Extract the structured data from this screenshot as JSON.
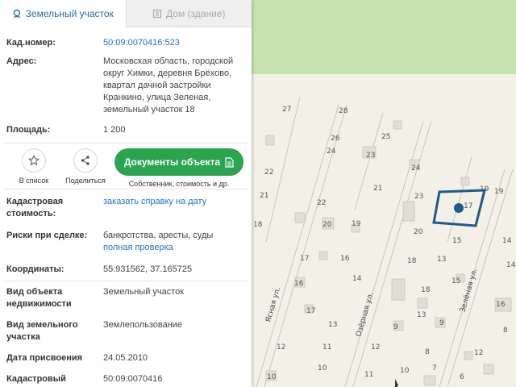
{
  "tabs": {
    "land": "Земельный участок",
    "building": "Дом (здание)"
  },
  "fields": {
    "cadastral_number": {
      "label": "Кад.номер:",
      "value": "50:09:0070416:523"
    },
    "address": {
      "label": "Адрес:",
      "lines": [
        "Московская область, городской",
        "округ Химки, деревня Брёхово,",
        "квартал дачной застройки",
        "Кранкино, улица Зеленая,",
        "земельный участок 18"
      ]
    },
    "area": {
      "label": "Площадь:",
      "value": "1 200"
    },
    "cadastral_value": {
      "label_lines": [
        "Кадастровая",
        "стоимость:"
      ],
      "link": "заказать справку на дату"
    },
    "risks": {
      "label": "Риски при сделке:",
      "value": "банкротства, аресты, суды",
      "link": "полная проверка"
    },
    "coordinates": {
      "label": "Координаты:",
      "value": "55.931562, 37.165725"
    },
    "object_type": {
      "label_lines": [
        "Вид объекта",
        "недвижимости"
      ],
      "value": "Земельный участок"
    },
    "land_type": {
      "label_lines": [
        "Вид земельного",
        "участка"
      ],
      "value": "Землепользование"
    },
    "assign_date": {
      "label": "Дата присвоения",
      "value": "24.05.2010"
    },
    "cadastral_partial": {
      "label": "Кадастровый",
      "value": "50:09:0070416"
    }
  },
  "actions": {
    "add_to_list": "В список",
    "share": "Поделиться",
    "docs_button": "Документы объекта",
    "docs_sub": "Собственник, стоимость и др."
  },
  "map": {
    "streets": [
      "Ясная ул.",
      "Озёрная ул.",
      "Зелёная ул."
    ],
    "house_numbers": [
      "27",
      "28",
      "26",
      "25",
      "24",
      "23",
      "24",
      "21",
      "22",
      "23",
      "22",
      "19",
      "21",
      "20",
      "19",
      "18",
      "17",
      "16",
      "15",
      "18",
      "14",
      "13",
      "16",
      "15",
      "14",
      "14",
      "13",
      "12",
      "11",
      "12",
      "10",
      "11",
      "10",
      "13",
      "19",
      "17",
      "20",
      "9",
      "8",
      "7",
      "10",
      "6",
      "8",
      "12",
      "18",
      "16",
      "17",
      "9"
    ],
    "accent": "#1e5a8c"
  },
  "colors": {
    "link": "#2a73b8",
    "tab_active": "#2b6fa0",
    "docs_button": "#2aa44f",
    "park": "#c7e2b0",
    "map_bg": "#f3f0e8"
  }
}
